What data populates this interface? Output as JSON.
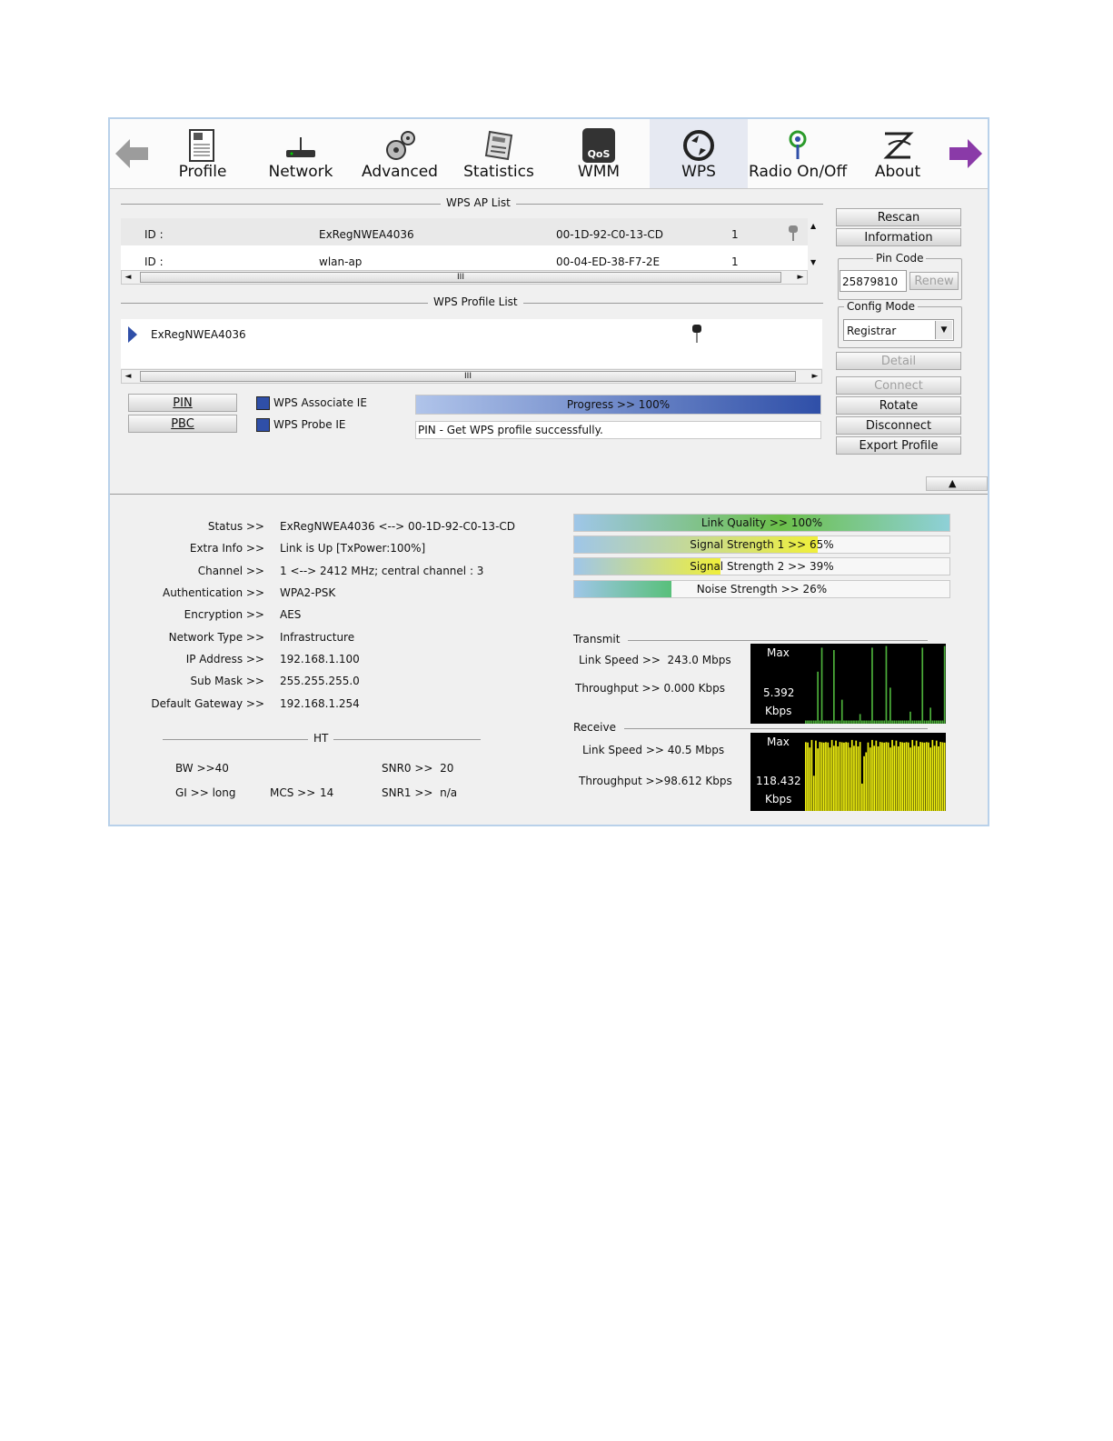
{
  "toolbar": {
    "items": [
      {
        "label": "Profile"
      },
      {
        "label": "Network"
      },
      {
        "label": "Advanced"
      },
      {
        "label": "Statistics"
      },
      {
        "label": "WMM",
        "icon_text": "QoS"
      },
      {
        "label": "WPS"
      },
      {
        "label": "Radio On/Off"
      },
      {
        "label": "About"
      }
    ],
    "active": "WPS"
  },
  "wps_ap_list": {
    "title": "WPS AP List",
    "rows": [
      {
        "id_label": "ID :",
        "ssid": "ExRegNWEA4036",
        "bssid": "00-1D-92-C0-13-CD",
        "channel": "1"
      },
      {
        "id_label": "ID :",
        "ssid": "wlan-ap",
        "bssid": "00-04-ED-38-F7-2E",
        "channel": "1"
      }
    ],
    "scroll_grip": "III"
  },
  "wps_profile_list": {
    "title": "WPS Profile List",
    "rows": [
      {
        "name": "ExRegNWEA4036"
      }
    ],
    "scroll_grip": "III"
  },
  "side": {
    "rescan": "Rescan",
    "information": "Information",
    "pin_code_caption": "Pin Code",
    "pin_code_value": "25879810",
    "renew": "Renew",
    "config_mode_caption": "Config Mode",
    "config_mode_value": "Registrar",
    "detail": "Detail",
    "connect": "Connect",
    "rotate": "Rotate",
    "disconnect": "Disconnect",
    "export_profile": "Export Profile"
  },
  "wps_actions": {
    "pin": "PIN",
    "pbc": "PBC",
    "associate_ie": "WPS Associate IE",
    "probe_ie": "WPS Probe IE",
    "progress_text": "Progress >> 100%",
    "progress_value": 100,
    "message": "PIN - Get WPS profile successfully."
  },
  "status": {
    "rows": [
      {
        "label": "Status >>",
        "value": "ExRegNWEA4036 <--> 00-1D-92-C0-13-CD"
      },
      {
        "label": "Extra Info >>",
        "value": "Link is Up [TxPower:100%]"
      },
      {
        "label": "Channel >>",
        "value": "1 <--> 2412 MHz; central channel : 3"
      },
      {
        "label": "Authentication >>",
        "value": "WPA2-PSK"
      },
      {
        "label": "Encryption >>",
        "value": "AES"
      },
      {
        "label": "Network Type >>",
        "value": "Infrastructure"
      },
      {
        "label": "IP Address >>",
        "value": "192.168.1.100"
      },
      {
        "label": "Sub Mask >>",
        "value": "255.255.255.0"
      },
      {
        "label": "Default Gateway >>",
        "value": "192.168.1.254"
      }
    ]
  },
  "ht": {
    "title": "HT",
    "bw": "BW >>40",
    "gi": "GI >> long",
    "mcs_label": "MCS >>",
    "mcs_value": "14",
    "snr0": "SNR0 >>  20",
    "snr1": "SNR1 >>  n/a"
  },
  "quality": {
    "bars": [
      {
        "text": "Link Quality >> 100%",
        "value": 100
      },
      {
        "text": "Signal Strength 1 >> 65%",
        "value": 65
      },
      {
        "text": "Signal Strength 2 >> 39%",
        "value": 39
      },
      {
        "text": "Noise Strength >> 26%",
        "value": 26
      }
    ]
  },
  "transmit": {
    "title": "Transmit",
    "link_speed": "Link Speed >>  243.0 Mbps",
    "throughput": "Throughput >> 0.000 Kbps",
    "graph_max": "Max",
    "graph_value": "5.392",
    "graph_unit": "Kbps"
  },
  "receive": {
    "title": "Receive",
    "link_speed": "Link Speed >> 40.5 Mbps",
    "throughput": "Throughput >>98.612 Kbps",
    "graph_max": "Max",
    "graph_value": "118.432",
    "graph_unit": "Kbps"
  },
  "colors": {
    "accent_blue": "#2f4fa8",
    "tx_graph": "#4caf3a",
    "rx_graph": "#f2f20f"
  }
}
